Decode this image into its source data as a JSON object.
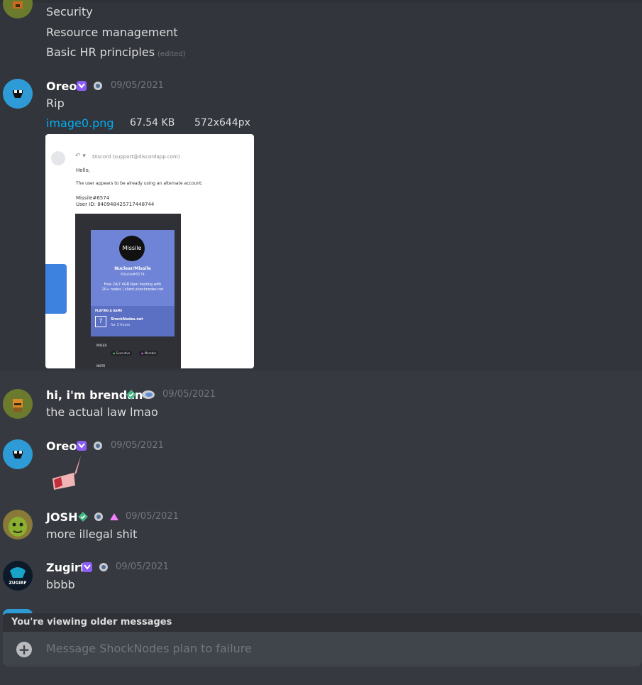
{
  "colors": {
    "background": "#36393f",
    "link": "#00aff4",
    "timestamp": "#72767d",
    "avatar_blue": "#2e9bd6"
  },
  "continued_lines": [
    "Security",
    "Resource management",
    "Basic HR principles"
  ],
  "edited_label": "(edited)",
  "messages": [
    {
      "author": "Oreo",
      "timestamp": "09/05/2021",
      "text": "Rip",
      "badges": [
        "nitro-icon",
        "boost-icon"
      ],
      "attachment": {
        "filename": "image0.png",
        "size": "67.54 KB",
        "dimensions": "572x644px"
      }
    },
    {
      "author": "hi, i'm brendan",
      "timestamp": "09/05/2021",
      "text": "the actual law lmao",
      "badges": [
        "verified-diamond-icon",
        "boost-icon"
      ]
    },
    {
      "author": "Oreo",
      "timestamp": "09/05/2021",
      "text": "",
      "badges": [
        "nitro-icon",
        "boost-icon"
      ]
    },
    {
      "author": "JOSH",
      "timestamp": "09/05/2021",
      "text": "more illegal shit",
      "badges": [
        "verified-diamond-icon",
        "boost-icon",
        "triangle-icon"
      ]
    },
    {
      "author": "Zugirf",
      "timestamp": "09/05/2021",
      "text": "bbbb",
      "badges": [
        "nitro-icon",
        "boost-icon"
      ]
    }
  ],
  "embedded_email": {
    "from": "Discord (support@discordapp.com)",
    "greeting": "Hello,",
    "body": "The user appears to be already using an alternate account:",
    "user_tag": "Missile#6574",
    "user_id": "User ID: 840948425717448744",
    "profile_name": "Nuclear/Missile",
    "profile_tag": "Missile#6574",
    "avatar_text": "Missile",
    "status": "Free 24/7 4GB Ram hosting with 20+ nodes | client.shocknodes.net",
    "playing_label": "PLAYING A GAME",
    "game_name": "ShockNodes.net",
    "game_time": "for 3 hours",
    "roles_label": "ROLES",
    "roles": [
      "Executive",
      "Member"
    ],
    "note_label": "NOTE"
  },
  "older_messages_bar": "You're viewing older messages",
  "composer": {
    "placeholder": "Message ShockNodes plan to failure"
  }
}
